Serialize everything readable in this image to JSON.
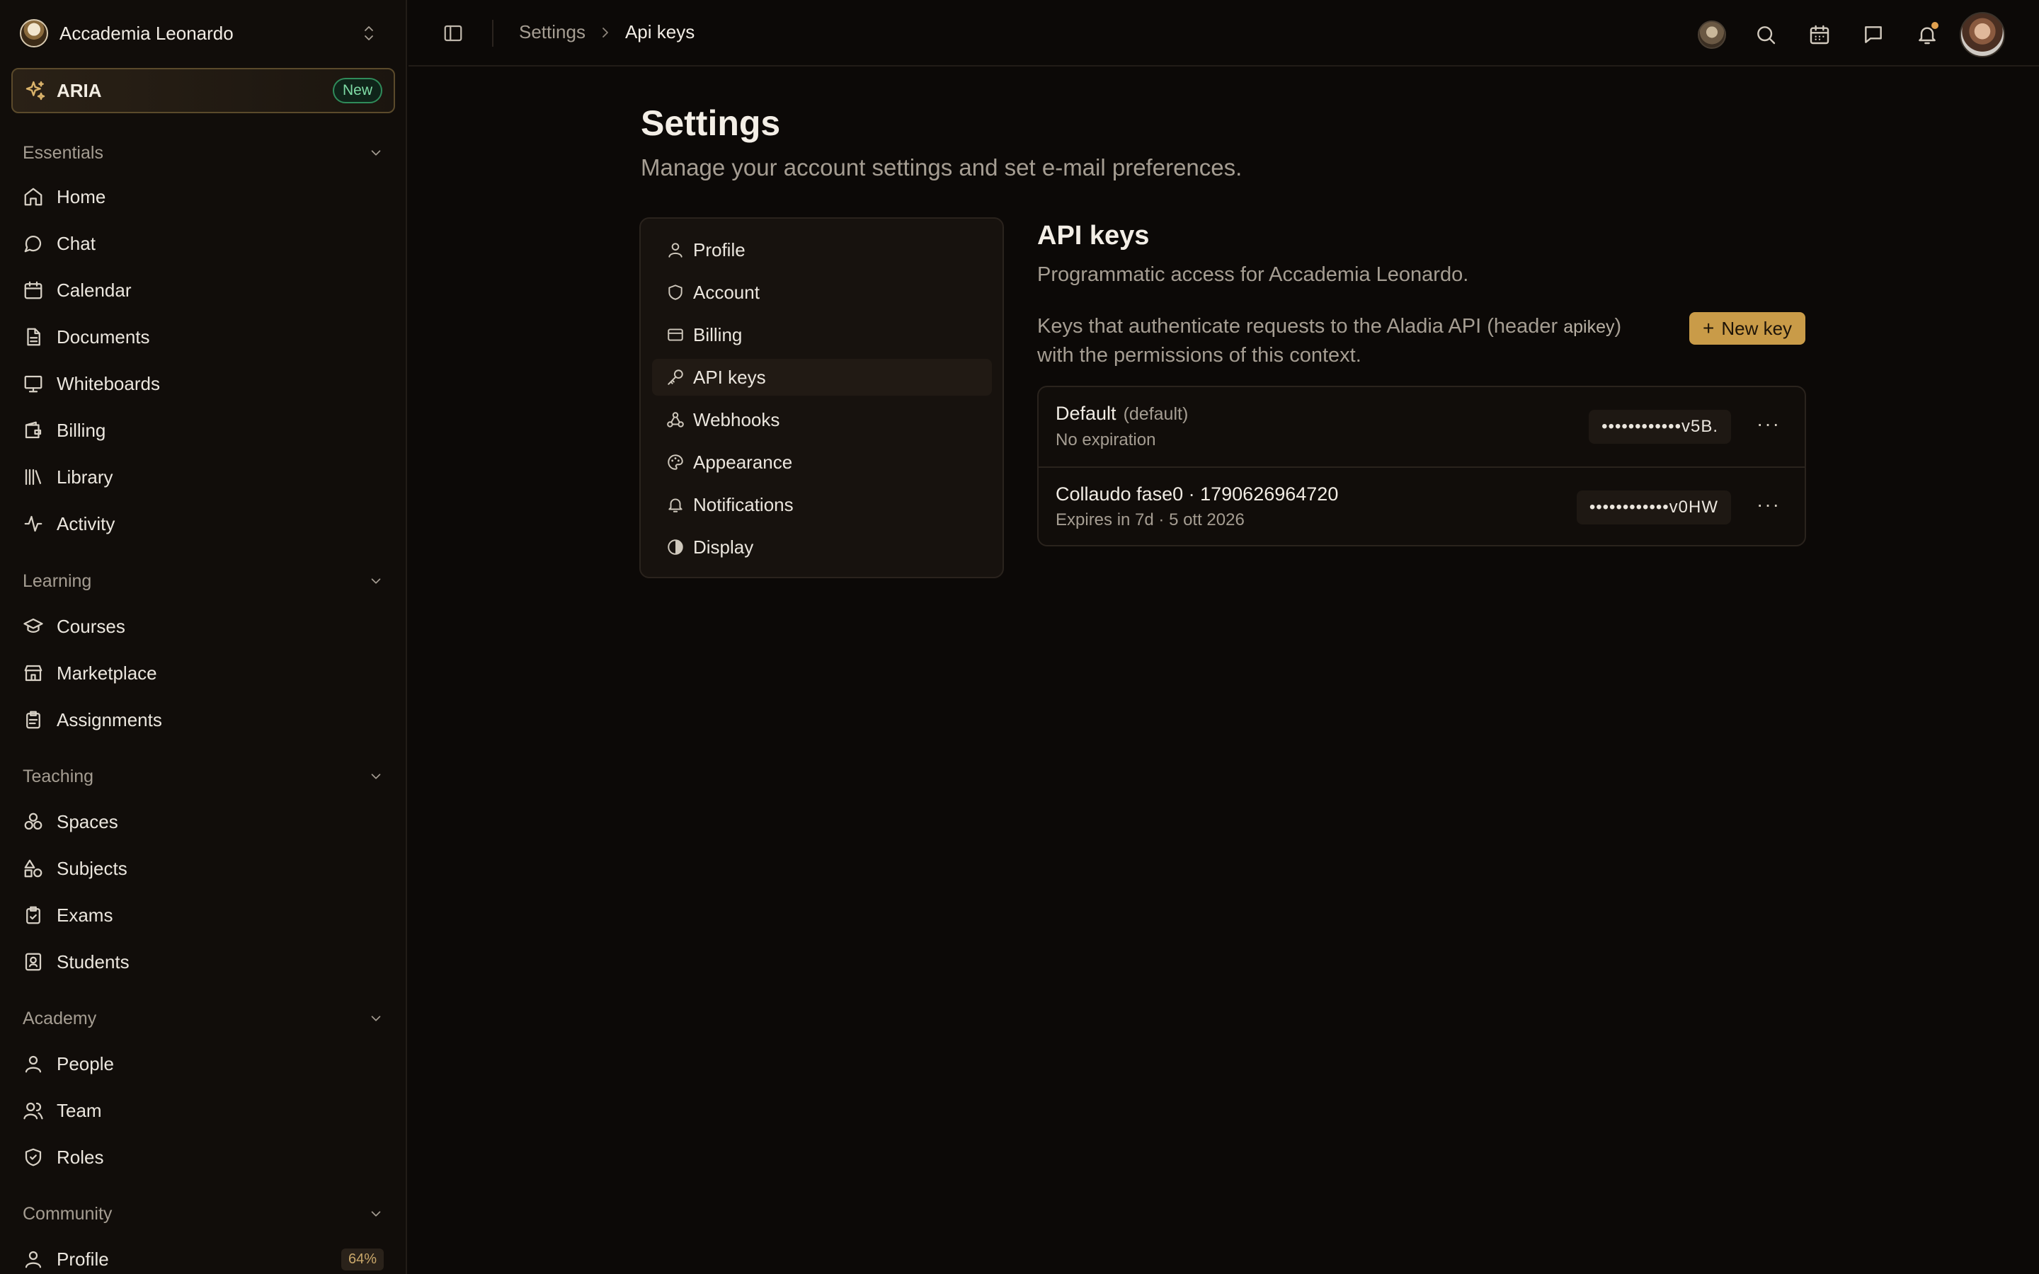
{
  "org": {
    "name": "Accademia Leonardo"
  },
  "aria": {
    "label": "ARIA",
    "badge": "New"
  },
  "sidebar": {
    "sections": [
      {
        "title": "Essentials",
        "items": [
          "Home",
          "Chat",
          "Calendar",
          "Documents",
          "Whiteboards",
          "Billing",
          "Library",
          "Activity"
        ]
      },
      {
        "title": "Learning",
        "items": [
          "Courses",
          "Marketplace",
          "Assignments"
        ]
      },
      {
        "title": "Teaching",
        "items": [
          "Spaces",
          "Subjects",
          "Exams",
          "Students"
        ]
      },
      {
        "title": "Academy",
        "items": [
          "People",
          "Team",
          "Roles"
        ]
      },
      {
        "title": "Community",
        "items": [
          "Profile"
        ]
      }
    ],
    "profile_progress": "64%"
  },
  "breadcrumb": {
    "parent": "Settings",
    "current": "Api keys"
  },
  "page": {
    "title": "Settings",
    "subtitle": "Manage your account settings and set e-mail preferences."
  },
  "settings_nav": [
    "Profile",
    "Account",
    "Billing",
    "API keys",
    "Webhooks",
    "Appearance",
    "Notifications",
    "Display"
  ],
  "api": {
    "title": "API keys",
    "subtitle": "Programmatic access for Accademia Leonardo.",
    "desc_part1": "Keys that authenticate requests to the Aladia API (header ",
    "desc_code": "apikey",
    "desc_part2": ") with the permissions of this context.",
    "new_key_label": "New key",
    "keys": [
      {
        "name": "Default",
        "tag": "(default)",
        "meta": "No expiration",
        "masked": "••••••••••••v5B."
      },
      {
        "name": "Collaudo fase0 · 1790626964720",
        "tag": "",
        "meta": "Expires in 7d · 5 ott 2026",
        "masked": "••••••••••••v0HW"
      }
    ]
  },
  "colors": {
    "accent": "#c99b48",
    "badge_green": "#2f8b5a",
    "background": "#0c0907"
  }
}
